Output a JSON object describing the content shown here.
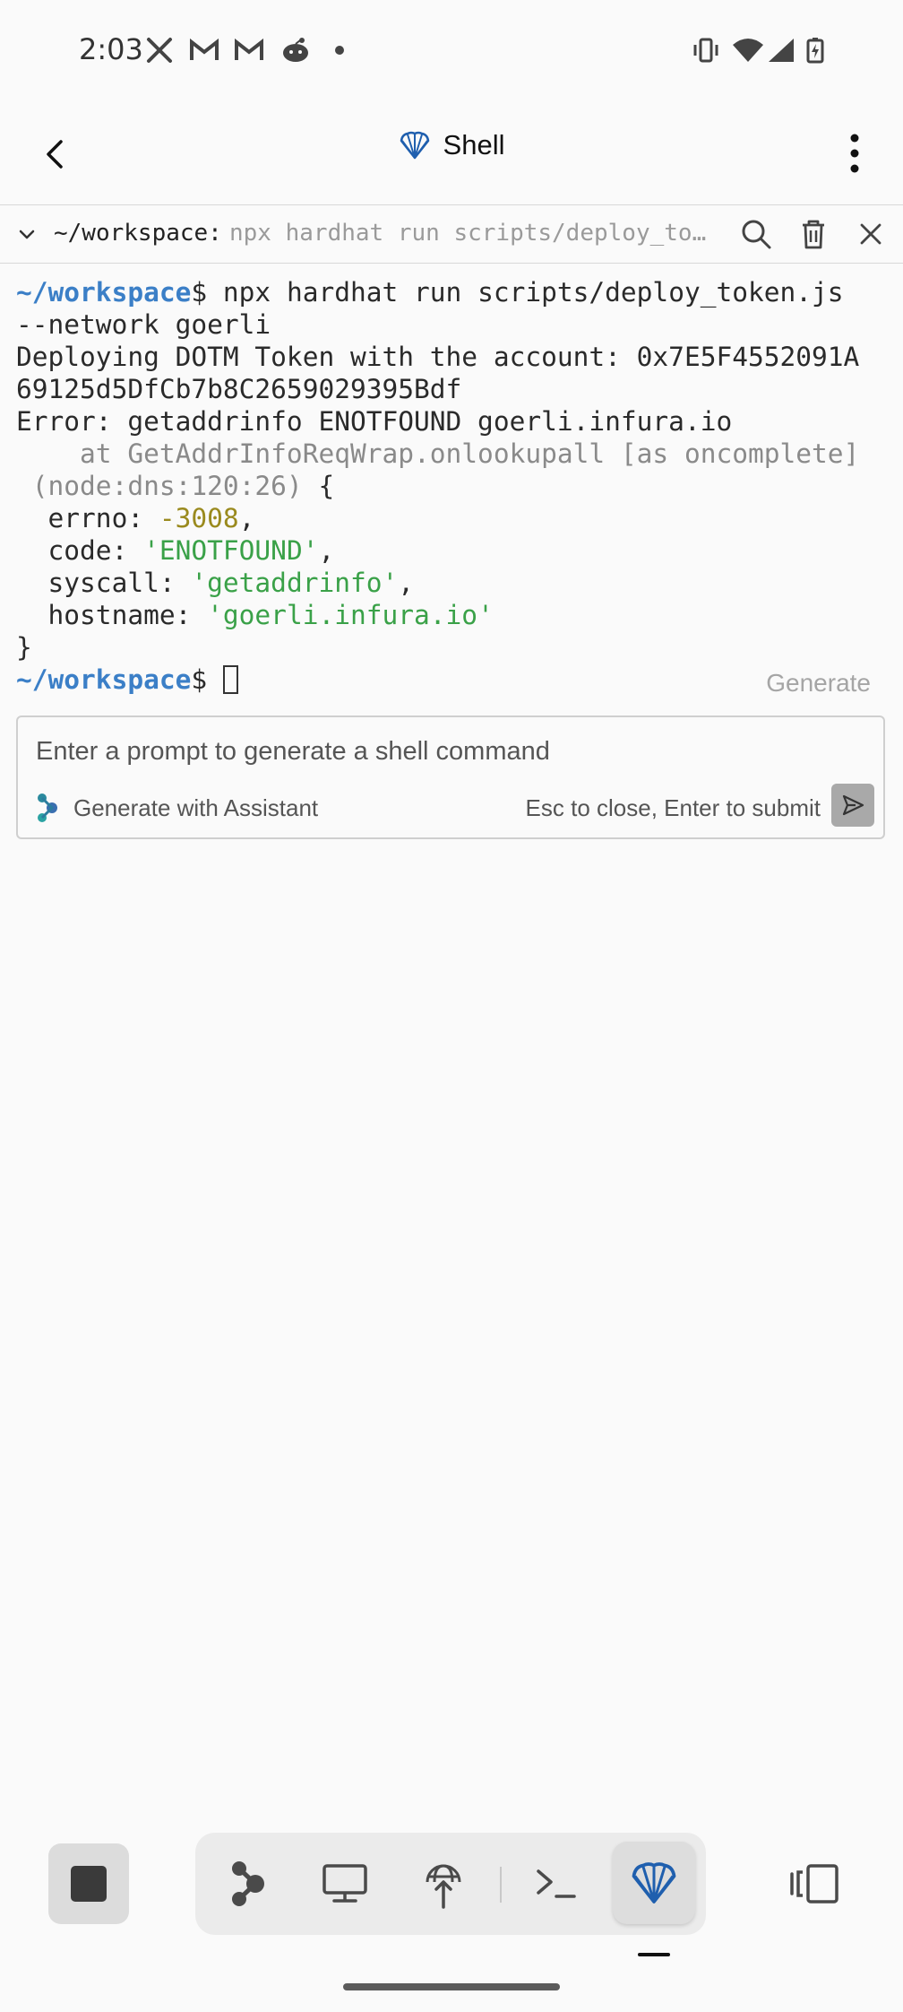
{
  "status_bar": {
    "time": "2:03",
    "notification_icons": [
      "x-icon",
      "gmail-icon",
      "gmail-icon",
      "reddit-icon",
      "dot-icon"
    ],
    "system_icons": [
      "vibrate-icon",
      "wifi-icon",
      "signal-icon",
      "battery-charging-icon"
    ]
  },
  "header": {
    "title": "Shell",
    "back_icon": "arrow-left-icon",
    "more_icon": "more-vert-icon"
  },
  "tab": {
    "path": "~/workspace:",
    "command": "npx hardhat run scripts/deploy_token.js --network goerli"
  },
  "terminal": {
    "prompt": "~/workspace",
    "command_line_1": "$ npx hardhat run scripts/deploy_token.js",
    "command_line_2": "--network goerli",
    "output_1": "Deploying DOTM Token with the account: 0x7E5F4552091A",
    "output_2": "69125d5DfCb7b8C2659029395Bdf",
    "error_line": "Error: getaddrinfo ENOTFOUND goerli.infura.io",
    "stack_line": "    at GetAddrInfoReqWrap.onlookupall [as oncomplete]",
    "stack_location": " (node:dns:120:26)",
    "brace_open": " {",
    "errno_key": "  errno: ",
    "errno_val": "-3008",
    "code_key": "  code: ",
    "code_val": "'ENOTFOUND'",
    "syscall_key": "  syscall: ",
    "syscall_val": "'getaddrinfo'",
    "hostname_key": "  hostname: ",
    "hostname_val": "'goerli.infura.io'",
    "comma": ",",
    "brace_close": "}",
    "dollar": "$ "
  },
  "generate_label": "Generate",
  "prompt_box": {
    "placeholder": "Enter a prompt to generate a shell command",
    "assistant_label": "Generate with Assistant",
    "hint": "Esc to close, Enter to submit"
  },
  "toolbar": {
    "items": [
      "stop-icon",
      "assistant-icon",
      "monitor-icon",
      "network-globe-icon",
      "terminal-icon",
      "shell-icon",
      "panel-toggle-icon"
    ]
  }
}
